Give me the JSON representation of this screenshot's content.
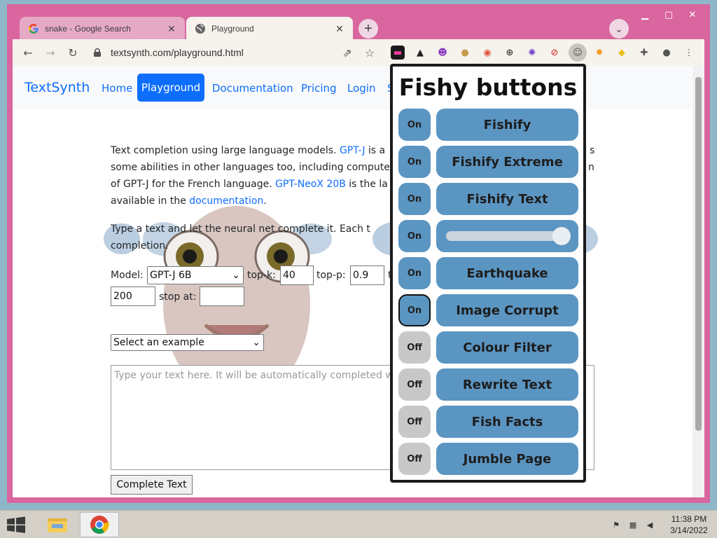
{
  "browser": {
    "tabs": [
      {
        "title": "snake - Google Search",
        "active": false
      },
      {
        "title": "Playground",
        "active": true
      }
    ],
    "new_tab_symbol": "+",
    "address": "textsynth.com/playground.html",
    "extensions": [
      "emoji-ext",
      "hat-ext",
      "skull-ext",
      "dog-ext",
      "ball-ext",
      "globe-ext",
      "virus-ext",
      "block-ext",
      "fishy-ext",
      "burst-ext",
      "pikachu-ext",
      "puzzle-ext",
      "profile-ext"
    ]
  },
  "page": {
    "brand": "TextSynth",
    "nav": [
      "Home",
      "Playground",
      "Documentation",
      "Pricing",
      "Login",
      "S"
    ],
    "intro_lines": [
      {
        "pre": "Text completion using large language models. ",
        "link": "GPT-J",
        "post": " is a",
        "tail": "s"
      },
      {
        "pre": "some abilities in other languages too, including compute",
        "link": "",
        "post": "",
        "tail": "n"
      },
      {
        "pre": "of GPT-J for the French language. ",
        "link": "GPT-NeoX 20B",
        "post": " is the la",
        "tail": ""
      },
      {
        "pre": "available in the ",
        "link": "documentation",
        "post": ".",
        "tail": ""
      }
    ],
    "instruction_lines": [
      "Type a text and let the neural net complete it. Each t",
      "completion."
    ],
    "form": {
      "model_label": "Model:",
      "model_value": "GPT-J 6B",
      "topk_label": "top-k:",
      "topk_value": "40",
      "topp_label": "top-p:",
      "topp_value": "0.9",
      "t_label": "t",
      "max_value": "200",
      "stop_label": "stop at:",
      "stop_value": "",
      "example_value": "Select an example",
      "prompt_placeholder": "Type your text here. It will be automatically completed w",
      "submit_label": "Complete Text"
    }
  },
  "fishy": {
    "title": "Fishy buttons",
    "rows": [
      {
        "toggle": "On",
        "state": "on",
        "label": "Fishify"
      },
      {
        "toggle": "On",
        "state": "on",
        "label": "Fishify Extreme"
      },
      {
        "toggle": "On",
        "state": "on",
        "label": "Fishify Text"
      },
      {
        "toggle": "On",
        "state": "on",
        "label": "",
        "slider_level": 0.95
      },
      {
        "toggle": "On",
        "state": "on",
        "label": "Earthquake"
      },
      {
        "toggle": "On",
        "state": "on-focused",
        "label": "Image Corrupt"
      },
      {
        "toggle": "Off",
        "state": "off",
        "label": "Colour Filter"
      },
      {
        "toggle": "Off",
        "state": "off",
        "label": "Rewrite Text"
      },
      {
        "toggle": "Off",
        "state": "off",
        "label": "Fish Facts"
      },
      {
        "toggle": "Off",
        "state": "off",
        "label": "Jumble Page"
      }
    ]
  },
  "taskbar": {
    "time": "11:38 PM",
    "date": "3/14/2022"
  },
  "colors": {
    "window_frame": "#d9669e",
    "link": "#0d6efd",
    "fishy_button": "#5b95c2",
    "fishy_off": "#c8c8c8"
  }
}
